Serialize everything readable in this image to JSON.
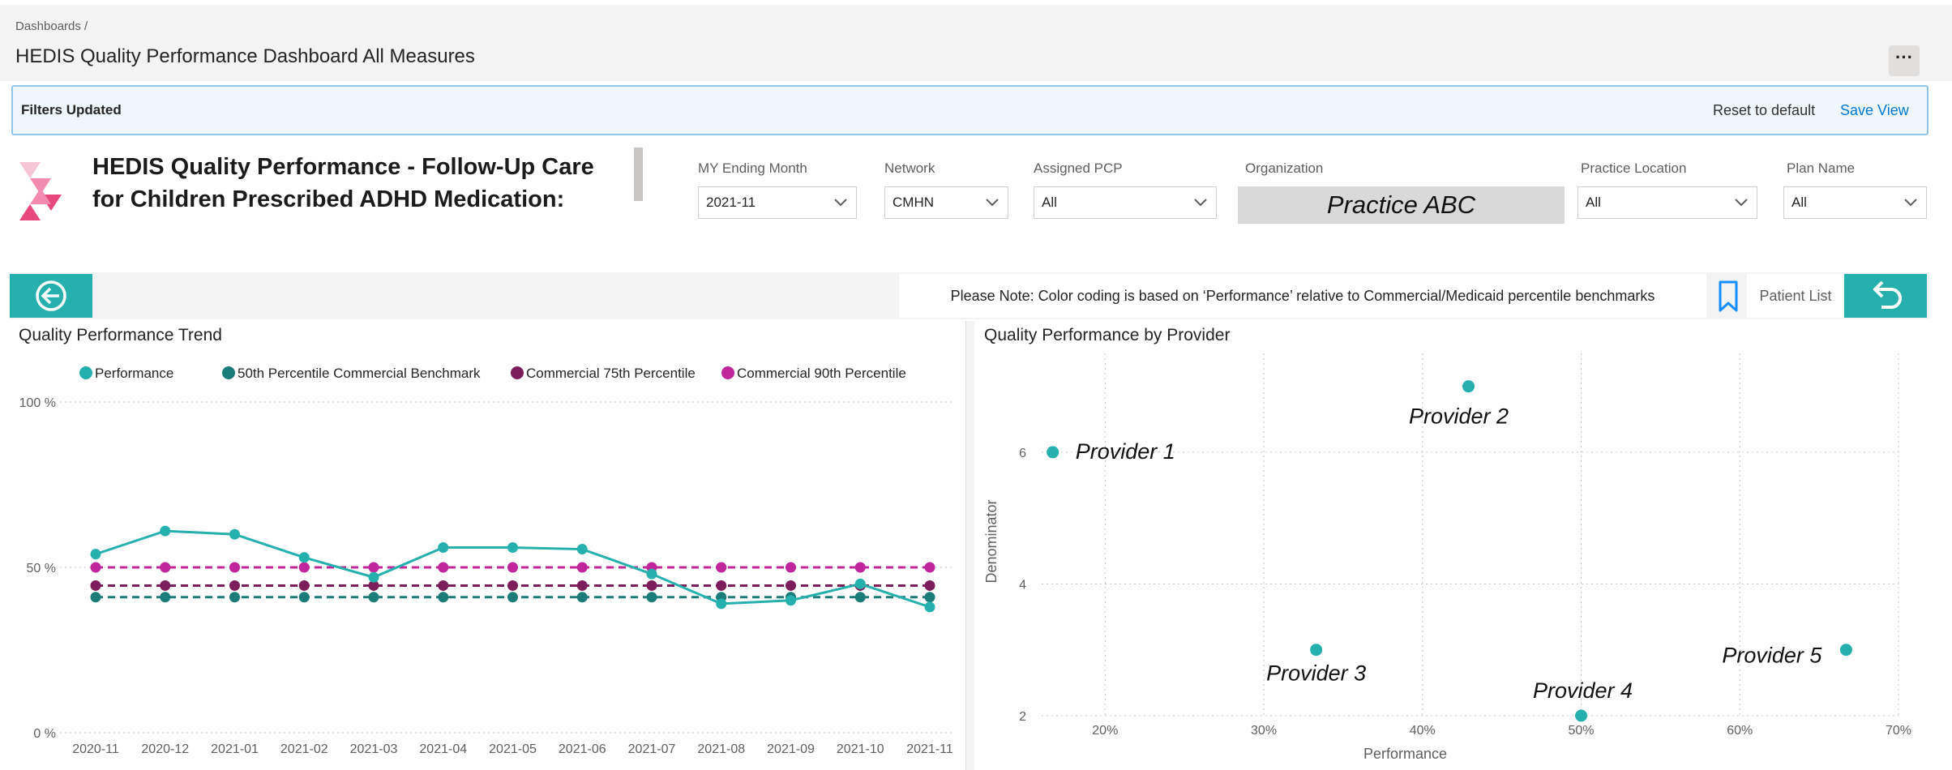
{
  "breadcrumb": "Dashboards /",
  "page_title": "HEDIS Quality Performance Dashboard All Measures",
  "more_label": "···",
  "filter_bar": {
    "status": "Filters Updated",
    "reset": "Reset to default",
    "save": "Save View"
  },
  "report_title": "HEDIS Quality Performance - Follow-Up Care for Children Prescribed ADHD Medication:",
  "slicers": {
    "month": {
      "label": "MY Ending Month",
      "value": "2021-11"
    },
    "network": {
      "label": "Network",
      "value": "CMHN"
    },
    "pcp": {
      "label": "Assigned PCP",
      "value": "All"
    },
    "organization": {
      "label": "Organization",
      "value": "Practice ABC"
    },
    "location": {
      "label": "Practice Location",
      "value": "All"
    },
    "plan": {
      "label": "Plan Name",
      "value": "All"
    }
  },
  "note": "Please Note: Color coding is based on ‘Performance’ relative to Commercial/Medicaid percentile benchmarks",
  "patient_list": "Patient List",
  "colors": {
    "teal": "#26b0ad",
    "dark_teal": "#1c7c7a",
    "plum": "#7c1e5c",
    "magenta": "#c0259b",
    "panel_bg": "#f3f3f3"
  },
  "icons": {
    "back": "arrow-left-circle-icon",
    "undo": "undo-icon",
    "bookmark": "bookmark-icon",
    "more": "more-icon",
    "dropdown": "chevron-down-icon"
  },
  "chart_data": [
    {
      "type": "line",
      "title": "Quality Performance Trend",
      "categories": [
        "2020-11",
        "2020-12",
        "2021-01",
        "2021-02",
        "2021-03",
        "2021-04",
        "2021-05",
        "2021-06",
        "2021-07",
        "2021-08",
        "2021-09",
        "2021-10",
        "2021-11"
      ],
      "yticks": [
        "0 %",
        "50 %",
        "100 %"
      ],
      "ylim": [
        0,
        100
      ],
      "legend_position": "top-left",
      "grid": true,
      "series": [
        {
          "name": "Performance",
          "color": "#26b0ad",
          "dashed": false,
          "values": [
            54,
            61,
            60,
            53,
            47,
            56,
            56,
            55.5,
            48,
            39,
            40,
            45,
            38
          ]
        },
        {
          "name": "50th Percentile Commercial Benchmark",
          "color": "#1c7c7a",
          "dashed": true,
          "values": [
            41,
            41,
            41,
            41,
            41,
            41,
            41,
            41,
            41,
            41,
            41,
            41,
            41
          ]
        },
        {
          "name": "Commercial 75th Percentile",
          "color": "#7c1e5c",
          "dashed": true,
          "values": [
            44.5,
            44.5,
            44.5,
            44.5,
            44.5,
            44.5,
            44.5,
            44.5,
            44.5,
            44.5,
            44.5,
            44.5,
            44.5
          ]
        },
        {
          "name": "Commercial 90th Percentile",
          "color": "#c0259b",
          "dashed": true,
          "values": [
            50,
            50,
            50,
            50,
            50,
            50,
            50,
            50,
            50,
            50,
            50,
            50,
            50
          ]
        }
      ]
    },
    {
      "type": "scatter",
      "title": "Quality Performance by Provider",
      "xlabel": "Performance",
      "ylabel": "Denominator",
      "xticks": [
        "20%",
        "30%",
        "40%",
        "50%",
        "60%",
        "70%"
      ],
      "yticks": [
        "2",
        "4",
        "6"
      ],
      "xlim": [
        16,
        70
      ],
      "ylim": [
        2,
        7.5
      ],
      "grid": true,
      "points": [
        {
          "label": "Provider 1",
          "x": 16.7,
          "y": 6
        },
        {
          "label": "Provider 2",
          "x": 42.9,
          "y": 7
        },
        {
          "label": "Provider 3",
          "x": 33.3,
          "y": 3
        },
        {
          "label": "Provider 4",
          "x": 50,
          "y": 2
        },
        {
          "label": "Provider 5",
          "x": 66.7,
          "y": 3
        }
      ]
    }
  ]
}
